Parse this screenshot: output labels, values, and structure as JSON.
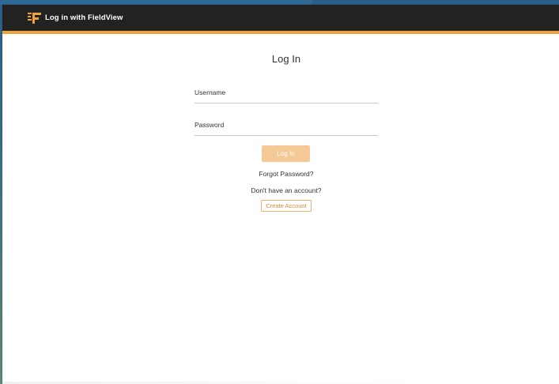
{
  "header": {
    "title": "Log in with FieldView",
    "logo_icon": "fieldview-logo-icon",
    "background": "#222222",
    "accent": "#f0a23a"
  },
  "login": {
    "title": "Log In",
    "username_label": "Username",
    "password_label": "Password",
    "submit_label": "Log In",
    "forgot_label": "Forgot Password?",
    "no_account_text": "Don't have an account?",
    "create_label": "Create Account",
    "button_color": "#f4c995"
  }
}
